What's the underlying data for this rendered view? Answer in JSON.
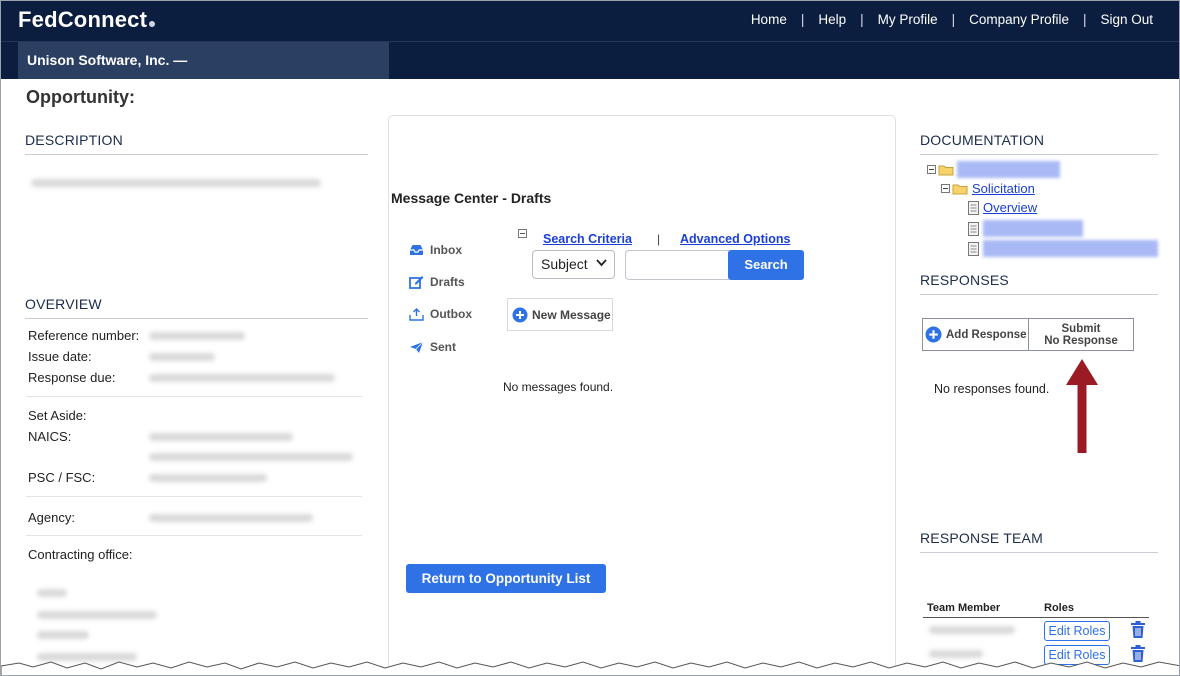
{
  "header": {
    "logo": "FedConnect",
    "nav": [
      "Home",
      "Help",
      "My Profile",
      "Company Profile",
      "Sign Out"
    ],
    "company": "Unison Software, Inc. —"
  },
  "page_title": "Opportunity:",
  "description": {
    "heading": "DESCRIPTION"
  },
  "overview": {
    "heading": "OVERVIEW",
    "labels": {
      "reference": "Reference number:",
      "issue": "Issue date:",
      "due": "Response due:",
      "set_aside": "Set Aside:",
      "naics": "NAICS:",
      "psc": "PSC / FSC:",
      "agency": "Agency:",
      "office": "Contracting office:"
    }
  },
  "message_center": {
    "title": "Message Center - Drafts",
    "folders": [
      "Inbox",
      "Drafts",
      "Outbox",
      "Sent"
    ],
    "search_criteria": "Search Criteria",
    "separator": "|",
    "advanced_options": "Advanced Options",
    "select_value": "Subject",
    "search_value": "",
    "search_button": "Search",
    "new_message": "New Message",
    "no_messages": "No messages found.",
    "return_button": "Return to Opportunity List"
  },
  "documentation": {
    "heading": "DOCUMENTATION",
    "folder": "Solicitation",
    "overview_link": "Overview"
  },
  "responses": {
    "heading": "RESPONSES",
    "add_response": "Add Response",
    "submit_line1": "Submit",
    "submit_line2": "No Response",
    "no_responses": "No responses found."
  },
  "response_team": {
    "heading": "RESPONSE TEAM",
    "col_member": "Team Member",
    "col_roles": "Roles",
    "edit_roles": "Edit Roles"
  },
  "colors": {
    "navy": "#0c1e3f",
    "button_blue": "#2f72e6",
    "link_blue": "#1a3fd6",
    "arrow": "#9b1b24"
  }
}
